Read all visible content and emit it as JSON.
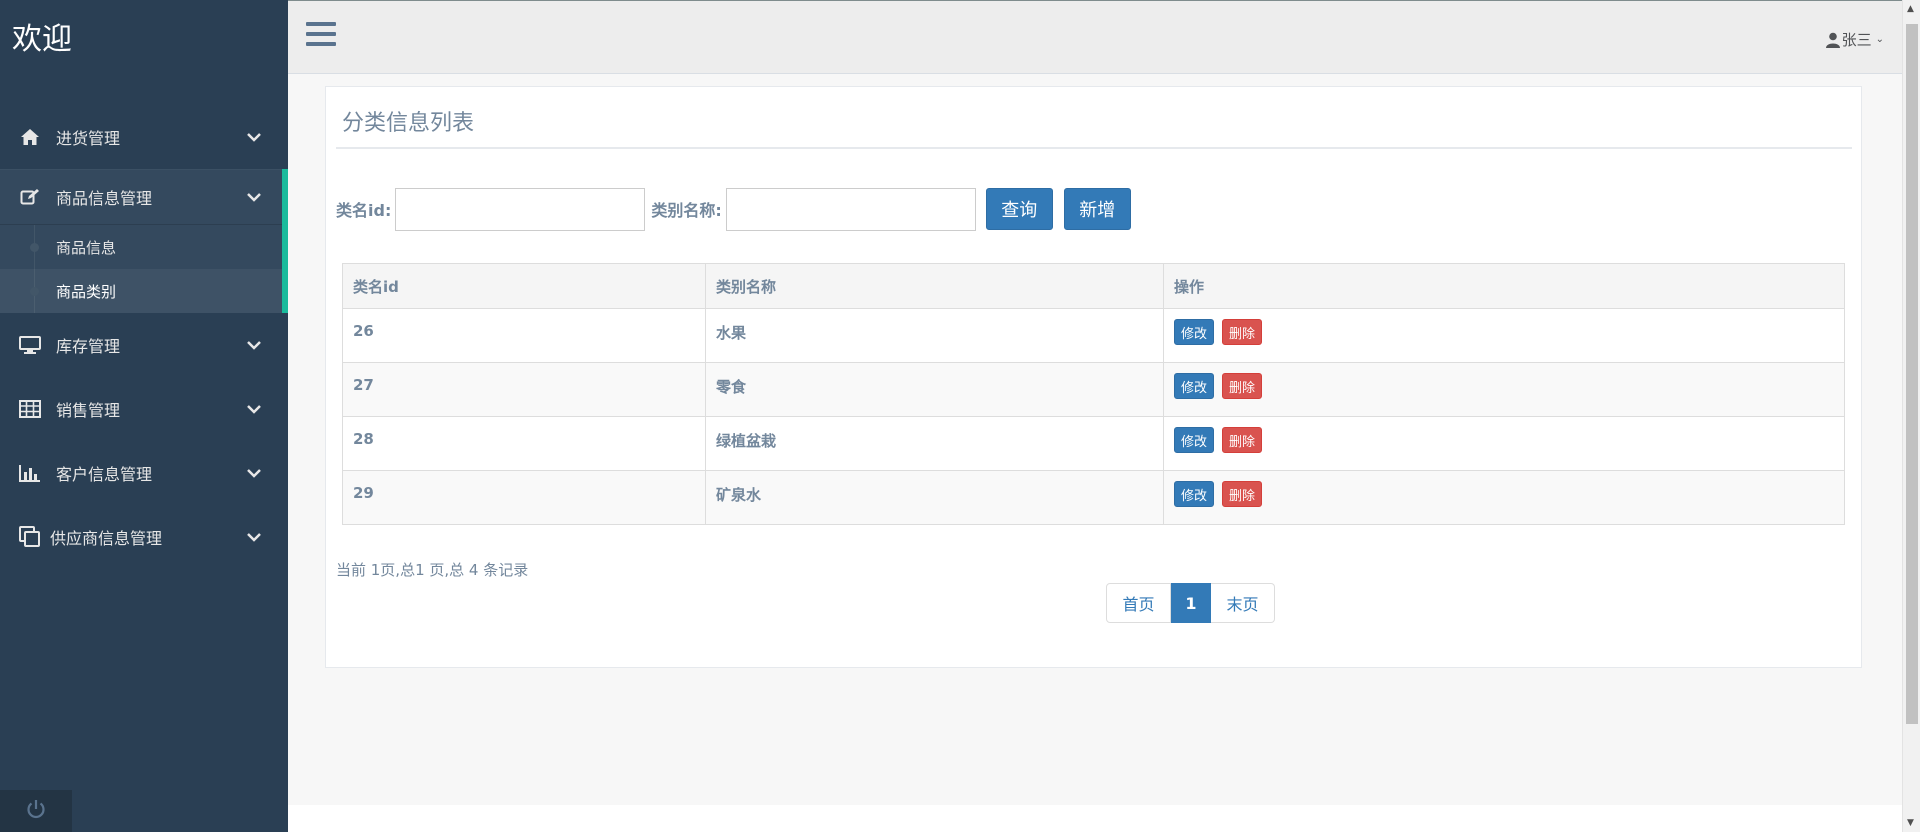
{
  "brand": "欢迎",
  "sidebar": {
    "items": [
      {
        "label": "进货管理",
        "icon": "home-icon"
      },
      {
        "label": "商品信息管理",
        "icon": "edit-icon"
      },
      {
        "label": "库存管理",
        "icon": "desktop-icon"
      },
      {
        "label": "销售管理",
        "icon": "table-icon"
      },
      {
        "label": "客户信息管理",
        "icon": "bar-chart-icon"
      },
      {
        "label": "供应商信息管理",
        "icon": "clone-icon"
      }
    ],
    "submenu": [
      {
        "label": "商品信息"
      },
      {
        "label": "商品类别"
      }
    ],
    "footer_icon": "power-icon"
  },
  "topnav": {
    "user": "张三"
  },
  "panel": {
    "title": "分类信息列表"
  },
  "search": {
    "id_label": "类名id:",
    "id_value": "",
    "name_label": "类别名称:",
    "name_value": "",
    "query_label": "查询",
    "add_label": "新增"
  },
  "table": {
    "headers": [
      "类名id",
      "类别名称",
      "操作"
    ],
    "rows": [
      {
        "id": "26",
        "name": "水果"
      },
      {
        "id": "27",
        "name": "零食"
      },
      {
        "id": "28",
        "name": "绿植盆栽"
      },
      {
        "id": "29",
        "name": "矿泉水"
      }
    ],
    "edit_label": "修改",
    "delete_label": "删除"
  },
  "pagination": {
    "info": "当前 1页,总1 页,总 4 条记录",
    "first": "首页",
    "current": "1",
    "last": "末页"
  },
  "colors": {
    "sidebar_bg": "#2a3f54",
    "active_accent": "#1abb9c",
    "primary": "#337ab7",
    "danger": "#d9534f"
  }
}
